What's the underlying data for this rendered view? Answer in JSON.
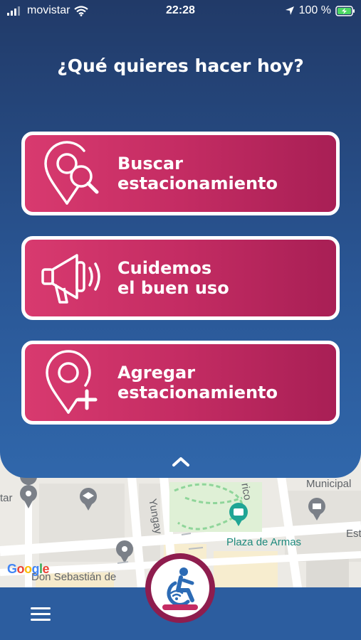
{
  "status_bar": {
    "carrier": "movistar",
    "time": "22:28",
    "battery": "100 %"
  },
  "heading": "¿Qué quieres hacer hoy?",
  "actions": [
    {
      "line1": "Buscar",
      "line2": "estacionamiento",
      "icon": "search-location-icon"
    },
    {
      "line1": "Cuidemos",
      "line2": "el buen uso",
      "icon": "megaphone-icon"
    },
    {
      "line1": "Agregar",
      "line2": "estacionamiento",
      "icon": "add-location-icon"
    }
  ],
  "map": {
    "labels": {
      "municipal": "Municipal",
      "tar": "tar",
      "yungay": "Yungay",
      "rico": "rico",
      "plaza": "Plaza de Armas",
      "est": "Est",
      "street": "Don Sebastián de"
    },
    "logo": "Google"
  },
  "colors": {
    "panel_top": "#213a68",
    "panel_bottom": "#3067ab",
    "button_pink": "#c42c63",
    "bottom_bar": "#2c5d9f"
  }
}
